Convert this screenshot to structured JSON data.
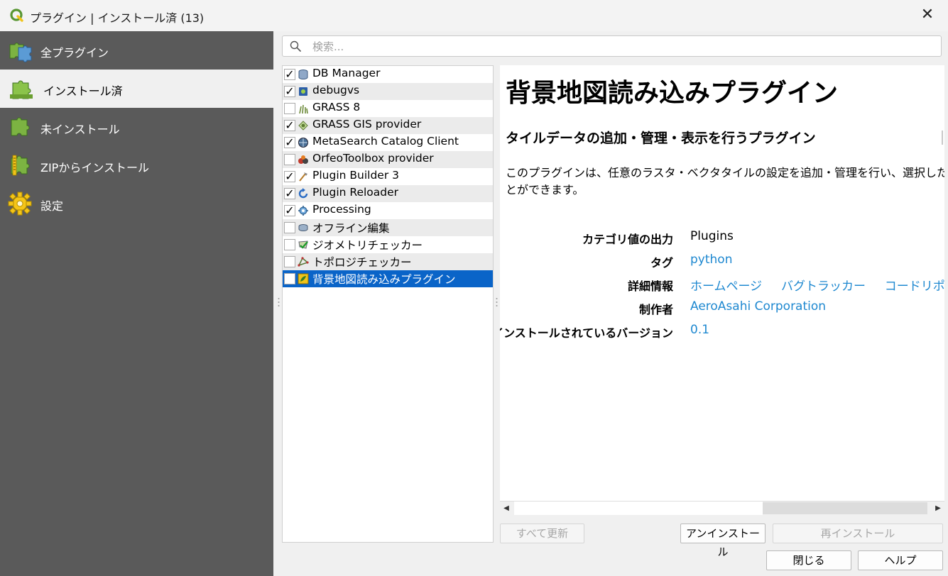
{
  "window": {
    "title": "プラグイン | インストール済 (13)",
    "close_glyph": "✕"
  },
  "sidebar": {
    "items": [
      {
        "label": "全プラグイン",
        "icon": "puzzle-pieces-icon",
        "active": false
      },
      {
        "label": "インストール済",
        "icon": "installed-puzzle-icon",
        "active": true
      },
      {
        "label": "未インストール",
        "icon": "puzzle-icon",
        "active": false
      },
      {
        "label": "ZIPからインストール",
        "icon": "zip-puzzle-icon",
        "active": false
      },
      {
        "label": "設定",
        "icon": "gear-icon",
        "active": false
      }
    ]
  },
  "search": {
    "placeholder": "検索..."
  },
  "plugins": [
    {
      "name": "DB Manager",
      "checked": true,
      "icon": "database-icon"
    },
    {
      "name": "debugvs",
      "checked": true,
      "icon": "debug-icon"
    },
    {
      "name": "GRASS 8",
      "checked": false,
      "icon": "grass-icon"
    },
    {
      "name": "GRASS GIS provider",
      "checked": true,
      "icon": "grass-provider-icon"
    },
    {
      "name": "MetaSearch Catalog Client",
      "checked": true,
      "icon": "metasearch-icon"
    },
    {
      "name": "OrfeoToolbox provider",
      "checked": false,
      "icon": "orfeo-icon"
    },
    {
      "name": "Plugin Builder 3",
      "checked": true,
      "icon": "plugin-builder-icon"
    },
    {
      "name": "Plugin Reloader",
      "checked": true,
      "icon": "reload-icon"
    },
    {
      "name": "Processing",
      "checked": true,
      "icon": "processing-gear-icon"
    },
    {
      "name": "オフライン編集",
      "checked": false,
      "icon": "offline-edit-icon"
    },
    {
      "name": "ジオメトリチェッカー",
      "checked": false,
      "icon": "geometry-checker-icon"
    },
    {
      "name": "トポロジチェッカー",
      "checked": false,
      "icon": "topology-checker-icon"
    },
    {
      "name": "背景地図読み込みプラグイン",
      "checked": false,
      "icon": "background-map-icon",
      "selected": true
    }
  ],
  "detail": {
    "title": "背景地図読み込みプラグイン",
    "subtitle": "タイルデータの追加・管理・表示を行うプラグイン",
    "description": "このプラグインは、任意のラスタ・ベクタタイルの設定を追加・管理を行い、選択した\nとができます。",
    "info": {
      "category_label": "カテゴリ値の出力",
      "category_value": "Plugins",
      "tags_label": "タグ",
      "tags_value": "python",
      "more_label": "詳細情報",
      "homepage": "ホームページ",
      "bugtracker": "バグトラッカー",
      "repository": "コードリポジトリ",
      "author_label": "制作者",
      "author_value": "AeroAsahi Corporation",
      "version_label": "インストールされているバージョン",
      "version_value": "0.1"
    }
  },
  "buttons": {
    "upgrade_all": "すべて更新",
    "uninstall": "アンインストール",
    "reinstall": "再インストール",
    "close": "閉じる",
    "help": "ヘルプ"
  }
}
